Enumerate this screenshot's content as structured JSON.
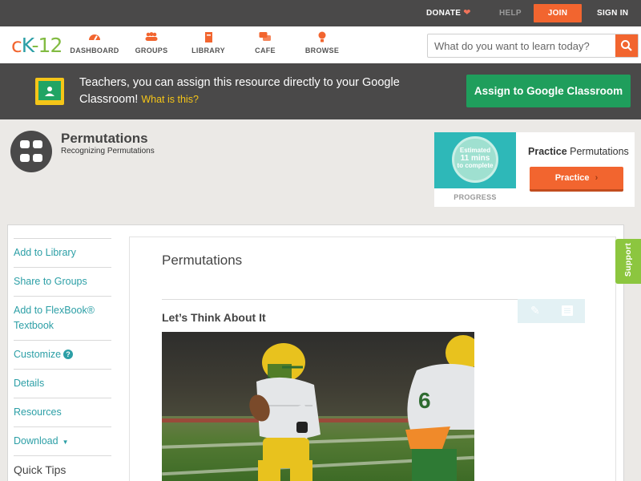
{
  "topbar": {
    "donate": "DONATE",
    "help": "HELP",
    "join": "JOIN",
    "signin": "SIGN IN"
  },
  "nav": {
    "logo": {
      "c": "c",
      "k": "K",
      "n": "-12"
    },
    "items": [
      {
        "label": "DASHBOARD",
        "icon": "dashboard-icon"
      },
      {
        "label": "GROUPS",
        "icon": "groups-icon"
      },
      {
        "label": "LIBRARY",
        "icon": "library-icon"
      },
      {
        "label": "CAFE",
        "icon": "cafe-icon"
      },
      {
        "label": "BROWSE",
        "icon": "browse-icon"
      }
    ],
    "search_placeholder": "What do you want to learn today?"
  },
  "banner": {
    "message": "Teachers, you can assign this resource directly to your Google Classroom!",
    "what_link": "What is this?",
    "assign_button": "Assign to Google Classroom"
  },
  "concept": {
    "title": "Permutations",
    "subtitle": "Recognizing Permutations"
  },
  "practice": {
    "estimate_line1": "Estimated",
    "estimate_line2": "11 mins",
    "estimate_line3": "to complete",
    "progress_label": "PROGRESS",
    "title_bold": "Practice",
    "title_rest": "Permutations",
    "button": "Practice"
  },
  "sidebar": {
    "add_library": "Add to Library",
    "share_groups": "Share to Groups",
    "add_flexbook_1": "Add to FlexBook®",
    "add_flexbook_2": "Textbook",
    "customize": "Customize",
    "details": "Details",
    "resources": "Resources",
    "download": "Download",
    "quick_tips": "Quick Tips"
  },
  "content": {
    "title": "Permutations",
    "section": "Let’s Think About It"
  },
  "support": "Support",
  "colors": {
    "accent": "#f2652f",
    "teal": "#2c9fa6",
    "green": "#1f9e5c",
    "dark": "#4a4949"
  }
}
